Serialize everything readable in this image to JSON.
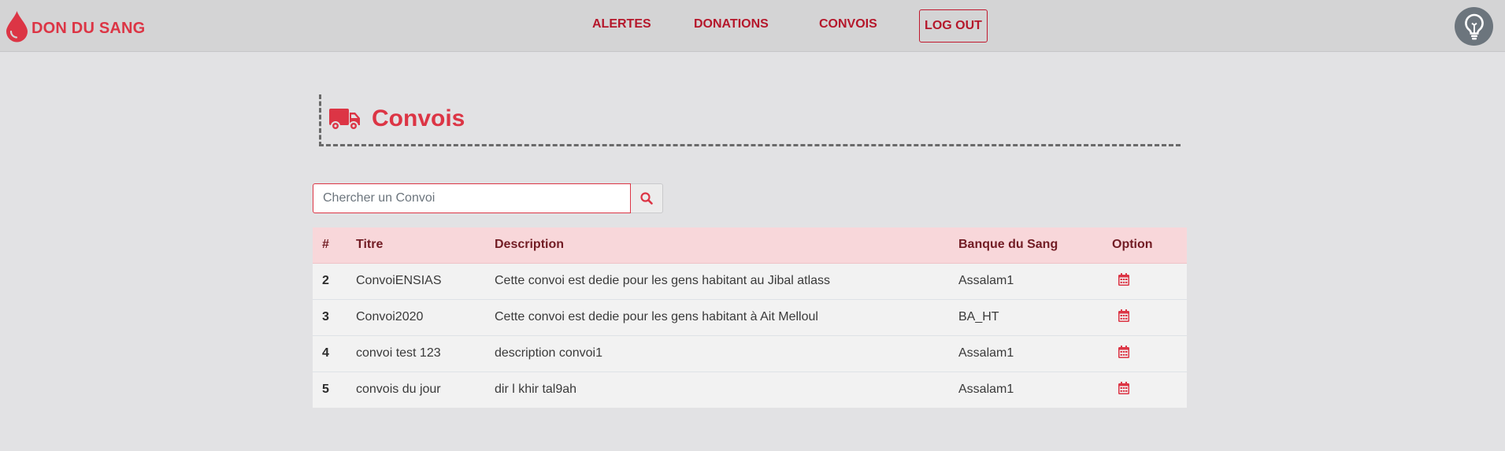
{
  "brand": {
    "name": "DON DU SANG",
    "icon": "blood-drop-icon"
  },
  "nav": {
    "links": [
      {
        "label": "ALERTES"
      },
      {
        "label": "DONATIONS"
      },
      {
        "label": "CONVOIS"
      }
    ],
    "logout_label": "LOG OUT",
    "help_icon": "lightbulb-icon"
  },
  "page": {
    "title": "Convois",
    "icon": "truck-icon"
  },
  "search": {
    "placeholder": "Chercher un Convoi",
    "value": "",
    "icon": "search-icon"
  },
  "table": {
    "columns": [
      "#",
      "Titre",
      "Description",
      "Banque du Sang",
      "Option"
    ],
    "rows": [
      {
        "id": "2",
        "titre": "ConvoiENSIAS",
        "description": "Cette convoi est dedie pour les gens habitant au Jibal atlass",
        "banque": "Assalam1"
      },
      {
        "id": "3",
        "titre": "Convoi2020",
        "description": "Cette convoi est dedie pour les gens habitant à Ait Melloul",
        "banque": "BA_HT"
      },
      {
        "id": "4",
        "titre": "convoi test 123",
        "description": "description convoi1",
        "banque": "Assalam1"
      },
      {
        "id": "5",
        "titre": "convois du jour",
        "description": "dir l khir tal9ah",
        "banque": "Assalam1"
      }
    ],
    "option_icon": "calendar-icon"
  },
  "colors": {
    "accent": "#dc3545",
    "nav_link": "#b5172b",
    "navbar_bg": "#d4d4d5",
    "page_bg": "#e2e2e4",
    "table_header_bg": "#f8d7da",
    "table_header_text": "#721c24",
    "help_button_bg": "#6c757d"
  }
}
